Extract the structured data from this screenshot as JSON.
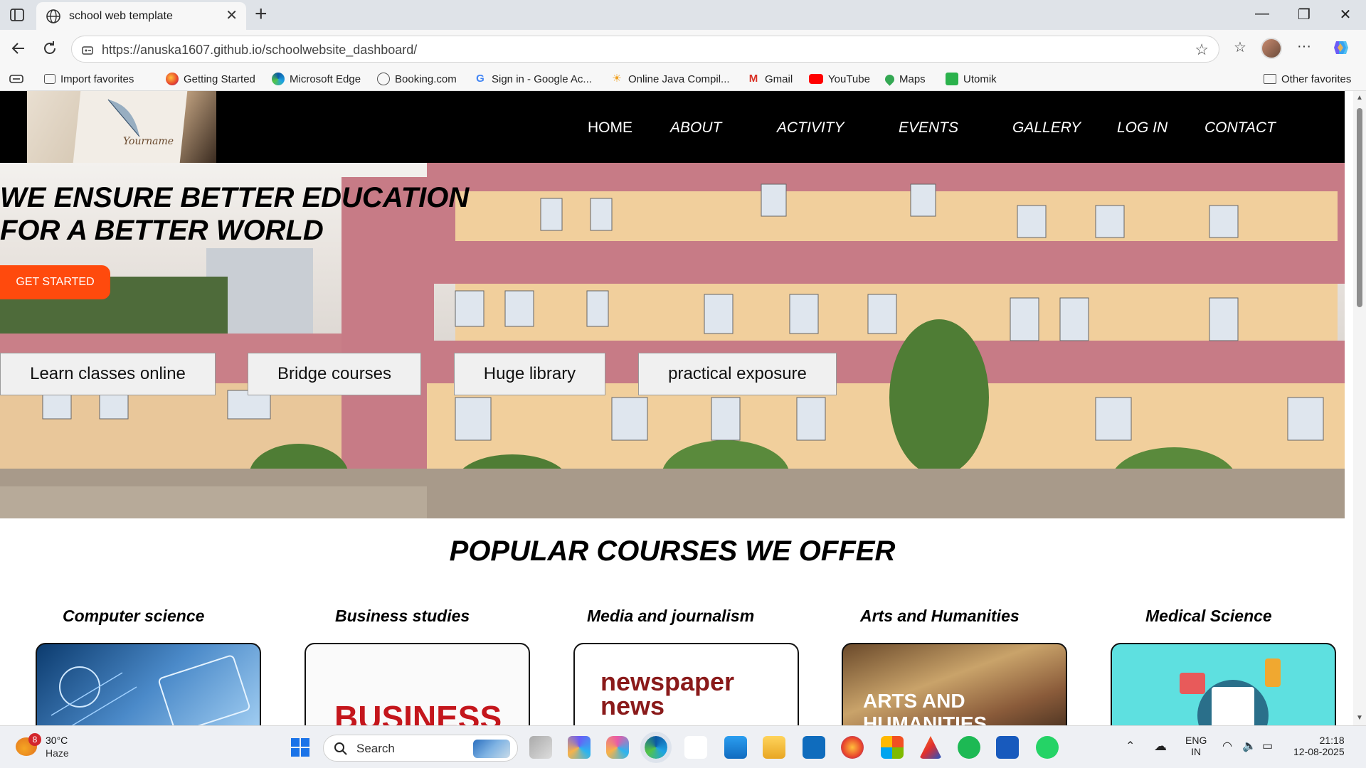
{
  "browser": {
    "tab_title": "school web template",
    "url": "https://anuska1607.github.io/schoolwebsite_dashboard/",
    "favorites": [
      {
        "label": "Import favorites",
        "color": "#666666"
      },
      {
        "label": "Getting Started",
        "color": "#e8452c"
      },
      {
        "label": "Microsoft Edge",
        "color": "#1a7fd6"
      },
      {
        "label": "Booking.com",
        "color": "#555555"
      },
      {
        "label": "Sign in - Google Ac...",
        "color": "#4285f4"
      },
      {
        "label": "Online Java Compil...",
        "color": "#f0a020"
      },
      {
        "label": "Gmail",
        "color": "#d93025"
      },
      {
        "label": "YouTube",
        "color": "#ff0000"
      },
      {
        "label": "Maps",
        "color": "#34a853"
      },
      {
        "label": "Utomik",
        "color": "#2bb24c"
      }
    ],
    "other_favorites": "Other favorites"
  },
  "site": {
    "logo_text": "Yourname",
    "nav": [
      "HOME",
      "ABOUT",
      "ACTIVITY",
      "EVENTS",
      "GALLERY",
      "LOG IN",
      "CONTACT"
    ],
    "hero": {
      "title_line1": "WE ENSURE BETTER EDUCATION",
      "title_line2": "FOR A BETTER WORLD",
      "cta": "GET STARTED",
      "features": [
        "Learn classes online",
        "Bridge courses",
        "Huge library",
        "practical exposure"
      ]
    },
    "courses": {
      "heading": "POPULAR COURSES WE OFFER",
      "items": [
        {
          "name": "Computer science"
        },
        {
          "name": "Business studies",
          "image_text": "BUSINESS"
        },
        {
          "name": "Media and journalism",
          "image_text": "newspaper news"
        },
        {
          "name": "Arts and Humanities",
          "image_text": "ARTS AND HUMANITIES"
        },
        {
          "name": "Medical Science"
        }
      ]
    }
  },
  "taskbar": {
    "weather_temp": "30°C",
    "weather_desc": "Haze",
    "weather_badge": "8",
    "search_placeholder": "Search",
    "lang_line1": "ENG",
    "lang_line2": "IN",
    "time": "21:18",
    "date": "12-08-2025"
  },
  "colors": {
    "cta": "#ff4a0d",
    "header_bg": "#000000",
    "accent": "#0078d4"
  }
}
